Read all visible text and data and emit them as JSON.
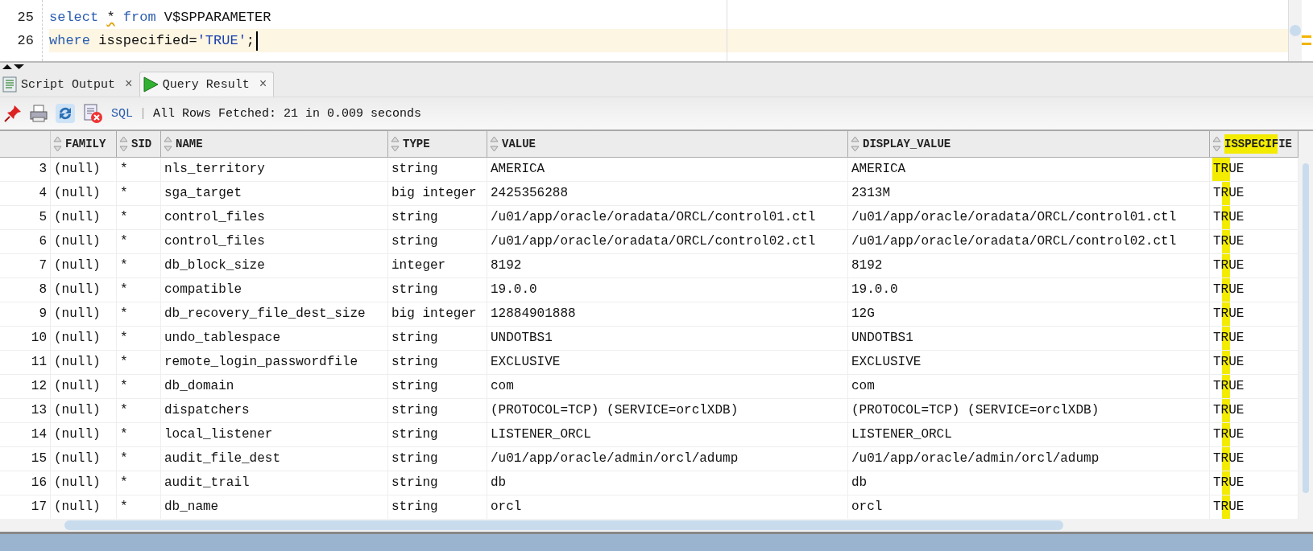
{
  "editor": {
    "lines": [
      {
        "number": "25",
        "current": false,
        "tokens": [
          {
            "kind": "keyword",
            "text": "select ",
            "warning": false
          },
          {
            "kind": "plain",
            "text": "*",
            "warning": true
          },
          {
            "kind": "keyword",
            "text": " from",
            "warning": false
          },
          {
            "kind": "plain",
            "text": " V$SPPARAMETER",
            "warning": false
          }
        ]
      },
      {
        "number": "26",
        "current": true,
        "tokens": [
          {
            "kind": "keyword",
            "text": "where",
            "warning": false
          },
          {
            "kind": "plain",
            "text": " isspecified=",
            "warning": false
          },
          {
            "kind": "string",
            "text": "'TRUE'",
            "warning": false
          },
          {
            "kind": "plain",
            "text": ";",
            "warning": false
          }
        ]
      }
    ]
  },
  "tabs": [
    {
      "label": "Script Output",
      "close": "×",
      "selected": false
    },
    {
      "label": "Query Result",
      "close": "×",
      "selected": true
    }
  ],
  "toolbar": {
    "sql_link": "SQL",
    "status": "All Rows Fetched: 21 in 0.009 seconds"
  },
  "table": {
    "columns": [
      "FAMILY",
      "SID",
      "NAME",
      "TYPE",
      "VALUE",
      "DISPLAY_VALUE",
      "ISSPECIFIE"
    ],
    "rows": [
      {
        "number": "3",
        "cells": [
          "(null)",
          "*",
          "nls_territory",
          "string",
          "AMERICA",
          "AMERICA",
          "TRUE"
        ]
      },
      {
        "number": "4",
        "cells": [
          "(null)",
          "*",
          "sga_target",
          "big integer",
          "2425356288",
          "2313M",
          "TRUE"
        ]
      },
      {
        "number": "5",
        "cells": [
          "(null)",
          "*",
          "control_files",
          "string",
          "/u01/app/oracle/oradata/ORCL/control01.ctl",
          "/u01/app/oracle/oradata/ORCL/control01.ctl",
          "TRUE"
        ]
      },
      {
        "number": "6",
        "cells": [
          "(null)",
          "*",
          "control_files",
          "string",
          "/u01/app/oracle/oradata/ORCL/control02.ctl",
          "/u01/app/oracle/oradata/ORCL/control02.ctl",
          "TRUE"
        ]
      },
      {
        "number": "7",
        "cells": [
          "(null)",
          "*",
          "db_block_size",
          "integer",
          "8192",
          "8192",
          "TRUE"
        ]
      },
      {
        "number": "8",
        "cells": [
          "(null)",
          "*",
          "compatible",
          "string",
          "19.0.0",
          "19.0.0",
          "TRUE"
        ]
      },
      {
        "number": "9",
        "cells": [
          "(null)",
          "*",
          "db_recovery_file_dest_size",
          "big integer",
          "12884901888",
          "12G",
          "TRUE"
        ]
      },
      {
        "number": "10",
        "cells": [
          "(null)",
          "*",
          "undo_tablespace",
          "string",
          "UNDOTBS1",
          "UNDOTBS1",
          "TRUE"
        ]
      },
      {
        "number": "11",
        "cells": [
          "(null)",
          "*",
          "remote_login_passwordfile",
          "string",
          "EXCLUSIVE",
          "EXCLUSIVE",
          "TRUE"
        ]
      },
      {
        "number": "12",
        "cells": [
          "(null)",
          "*",
          "db_domain",
          "string",
          "com",
          "com",
          "TRUE"
        ]
      },
      {
        "number": "13",
        "cells": [
          "(null)",
          "*",
          "dispatchers",
          "string",
          "(PROTOCOL=TCP) (SERVICE=orclXDB)",
          "(PROTOCOL=TCP) (SERVICE=orclXDB)",
          "TRUE"
        ]
      },
      {
        "number": "14",
        "cells": [
          "(null)",
          "*",
          "local_listener",
          "string",
          "LISTENER_ORCL",
          "LISTENER_ORCL",
          "TRUE"
        ]
      },
      {
        "number": "15",
        "cells": [
          "(null)",
          "*",
          "audit_file_dest",
          "string",
          "/u01/app/oracle/admin/orcl/adump",
          "/u01/app/oracle/admin/orcl/adump",
          "TRUE"
        ]
      },
      {
        "number": "16",
        "cells": [
          "(null)",
          "*",
          "audit_trail",
          "string",
          "db",
          "db",
          "TRUE"
        ]
      },
      {
        "number": "17",
        "cells": [
          "(null)",
          "*",
          "db_name",
          "string",
          "orcl",
          "orcl",
          "TRUE"
        ]
      }
    ]
  }
}
